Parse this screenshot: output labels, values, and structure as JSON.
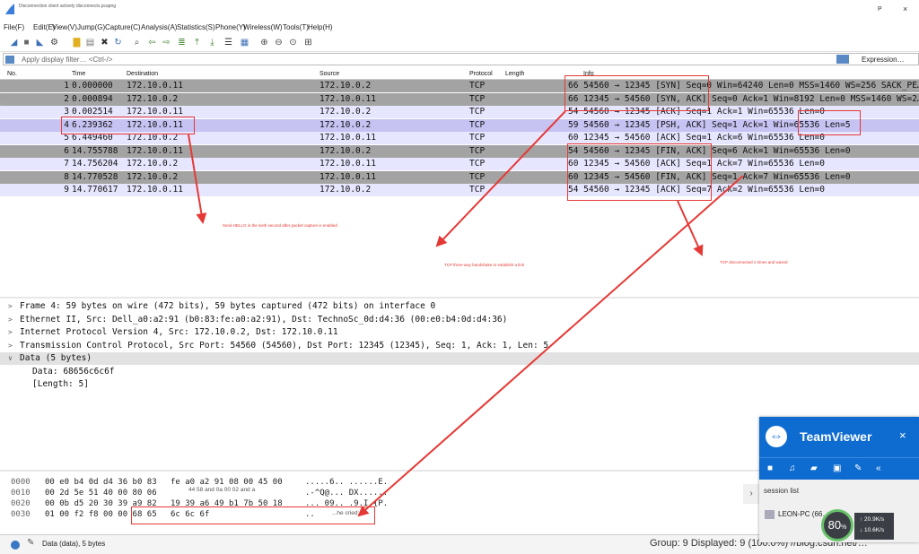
{
  "titlebar": {
    "title": "Disconnection client actively disconnects.pcapng",
    "p_label": "P",
    "close": "×"
  },
  "menu": [
    "File(F)",
    "Edit(E)",
    "View(V)",
    "Jump(G)",
    "Capture(C)",
    "Analysis(A)",
    "Statistics(S)",
    "Phone(Y)",
    "Wireless(W)",
    "Tools(T)",
    "Help(H)"
  ],
  "filter": {
    "placeholder": "Apply display filter… <Ctrl-/>",
    "expression": "Expression…",
    "plus": "+"
  },
  "columns": {
    "no": "No.",
    "time": "Time",
    "destination": "Destination",
    "source": "Source",
    "protocol": "Protocol",
    "length": "Length",
    "info": "Info"
  },
  "packets": [
    {
      "no": "1",
      "time": "0.000000",
      "dst": "172.10.0.11",
      "src": "172.10.0.2",
      "proto": "TCP",
      "info": "66 54560 → 12345 [SYN] Seq=0 Win=64240 Len=0 MSS=1460 WS=256 SACK_PE…"
    },
    {
      "no": "2",
      "time": "0.000894",
      "dst": "172.10.0.2",
      "src": "172.10.0.11",
      "proto": "TCP",
      "info": "66 12345 → 54560 [SYN, ACK] Seq=0 Ack=1 Win=8192 Len=0 MSS=1460 WS=2…"
    },
    {
      "no": "3",
      "time": "0.002514",
      "dst": "172.10.0.11",
      "src": "172.10.0.2",
      "proto": "TCP",
      "info": "54 54560 → 12345 [ACK] Seq=1 Ack=1 Win=65536 Len=0"
    },
    {
      "no": "4",
      "time": "6.239362",
      "dst": "172.10.0.11",
      "src": "172.10.0.2",
      "proto": "TCP",
      "info": "59 54560 → 12345 [PSH, ACK] Seq=1 Ack=1 Win=65536 Len=5"
    },
    {
      "no": "5",
      "time": "6.449460",
      "dst": "172.10.0.2",
      "src": "172.10.0.11",
      "proto": "TCP",
      "info": "60 12345 → 54560 [ACK] Seq=1 Ack=6 Win=65536 Len=0"
    },
    {
      "no": "6",
      "time": "14.755788",
      "dst": "172.10.0.11",
      "src": "172.10.0.2",
      "proto": "TCP",
      "info": "54 54560 → 12345 [FIN, ACK] Seq=6 Ack=1 Win=65536 Len=0"
    },
    {
      "no": "7",
      "time": "14.756204",
      "dst": "172.10.0.2",
      "src": "172.10.0.11",
      "proto": "TCP",
      "info": "60 12345 → 54560 [ACK] Seq=1 Ack=7 Win=65536 Len=0"
    },
    {
      "no": "8",
      "time": "14.770528",
      "dst": "172.10.0.2",
      "src": "172.10.0.11",
      "proto": "TCP",
      "info": "60 12345 → 54560 [FIN, ACK] Seq=1 Ack=7 Win=65536 Len=0"
    },
    {
      "no": "9",
      "time": "14.770617",
      "dst": "172.10.0.11",
      "src": "172.10.0.2",
      "proto": "TCP",
      "info": "54 54560 → 12345 [ACK] Seq=7 Ack=2 Win=65536 Len=0"
    }
  ],
  "row_colors": [
    "#a3a3a3",
    "#a3a3a3",
    "#e7e6ff",
    "#c6c2f2",
    "#e7e6ff",
    "#a3a3a3",
    "#e7e6ff",
    "#a3a3a3",
    "#e7e6ff"
  ],
  "details": [
    {
      "arrow": ">",
      "text": "Frame 4: 59 bytes on wire (472 bits), 59 bytes captured (472 bits) on interface 0"
    },
    {
      "arrow": ">",
      "text": "Ethernet II, Src: Dell_a0:a2:91 (b0:83:fe:a0:a2:91), Dst: TechnoSc_0d:d4:36 (00:e0:b4:0d:d4:36)"
    },
    {
      "arrow": ">",
      "text": "Internet Protocol Version 4, Src: 172.10.0.2, Dst: 172.10.0.11"
    },
    {
      "arrow": ">",
      "text": "Transmission Control Protocol, Src Port: 54560 (54560), Dst Port: 12345 (12345), Seq: 1, Ack: 1, Len: 5"
    },
    {
      "arrow": "∨",
      "text": "Data (5 bytes)"
    },
    {
      "arrow": "",
      "text": "Data: 68656c6c6f"
    },
    {
      "arrow": "",
      "text": "[Length: 5]"
    }
  ],
  "hex": [
    {
      "offset": "0000",
      "bytes1": "00 e0 b4 0d d4 36 b0 83",
      "bytes2": "fe a0 a2 91 08 00 45 00",
      "ascii": ".....6.. ......E."
    },
    {
      "offset": "0010",
      "bytes1": "00 2d 5e 51 40 00 80 06",
      "bytes2": "",
      "ascii": ".-^Q@... DX......"
    },
    {
      "offset": "0020",
      "bytes1": "00 0b d5 20 30 39 a9 82",
      "bytes2": "19 39 a6 49 b1 7b 50 18",
      "ascii": "... 09.. .9.I.{P."
    },
    {
      "offset": "0030",
      "bytes1": "01 00 f2 f8 00 00 68 65",
      "bytes2": "6c 6c 6f",
      "ascii": ".."
    }
  ],
  "annotations": {
    "hello_note": "Send HELLO in the sixth second after packet capture is enabled",
    "handshake_note": "TCP three-way handshake to establish a link",
    "wave_note": "TCP disconnected 4 times and waved",
    "hex_note_1": "44 58 and 0a 00 02 and a",
    "hex_note_2": "...he cried;"
  },
  "status": {
    "label": "Data (data), 5 bytes",
    "group": "Group: 9 Displayed: 9 (100.0%) //blog.csdn.net/…"
  },
  "teamviewer": {
    "name": "TeamViewer",
    "close": "×",
    "session_list": "session list",
    "pc": "LEON-PC (66…",
    "gauge": "80",
    "gauge_unit": "%",
    "up": "↑ 20.9K/s",
    "down": "↓ 10.6K/s"
  },
  "colors": {
    "accent": "#0e6cd1",
    "annotation": "#e53935",
    "selected_row": "#c6c2f2"
  }
}
